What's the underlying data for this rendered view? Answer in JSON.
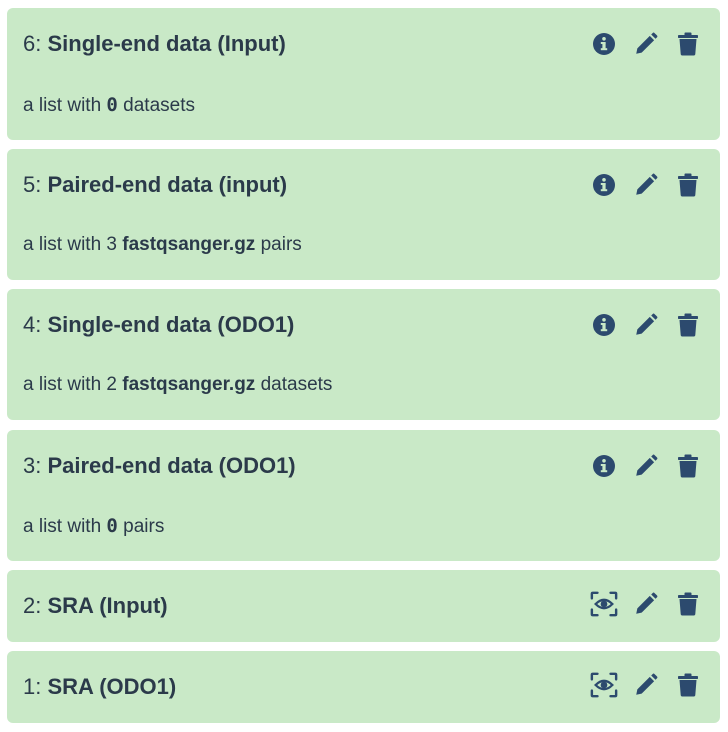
{
  "items": [
    {
      "hid": "6:",
      "name": "Single-end data (Input)",
      "desc_pre": "a list with ",
      "desc_count": "0",
      "desc_mid": " ",
      "desc_type": "",
      "desc_post": "datasets",
      "kind": "list"
    },
    {
      "hid": "5:",
      "name": "Paired-end data (input)",
      "desc_pre": "a list with 3 ",
      "desc_count": "",
      "desc_mid": "",
      "desc_type": "fastqsanger.gz",
      "desc_post": " pairs",
      "kind": "list"
    },
    {
      "hid": "4:",
      "name": "Single-end data (ODO1)",
      "desc_pre": "a list with 2 ",
      "desc_count": "",
      "desc_mid": "",
      "desc_type": "fastqsanger.gz",
      "desc_post": " datasets",
      "kind": "list"
    },
    {
      "hid": "3:",
      "name": "Paired-end data (ODO1)",
      "desc_pre": "a list with ",
      "desc_count": "0",
      "desc_mid": " ",
      "desc_type": "",
      "desc_post": "pairs",
      "kind": "list"
    },
    {
      "hid": "2:",
      "name": "SRA (Input)",
      "kind": "dataset"
    },
    {
      "hid": "1:",
      "name": "SRA (ODO1)",
      "kind": "dataset"
    }
  ],
  "icons": {
    "info": "info-circle-icon",
    "edit": "pencil-icon",
    "delete": "trash-icon",
    "view": "eye-scan-icon"
  },
  "colors": {
    "item_bg": "#c9e9c7",
    "icon": "#2c4a6e",
    "text": "#2b3a4a"
  }
}
